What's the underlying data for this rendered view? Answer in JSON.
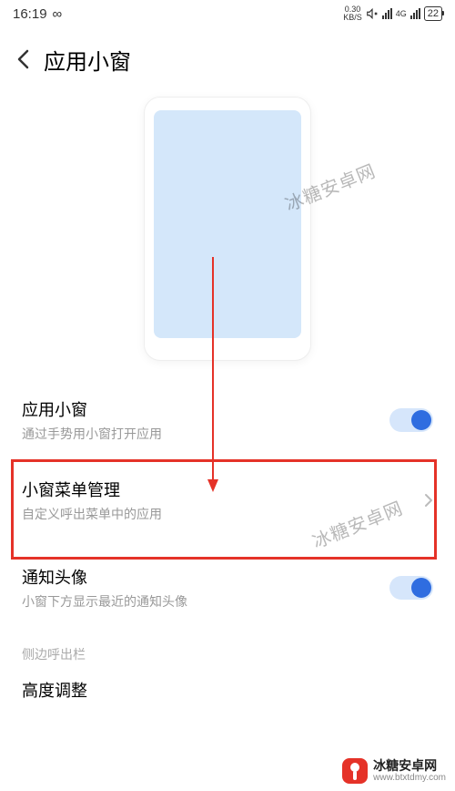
{
  "status": {
    "time": "16:19",
    "infinity_symbol": "∞",
    "speed_top": "0.30",
    "speed_bottom": "KB/S",
    "net_label": "4G",
    "battery": "22"
  },
  "header": {
    "title": "应用小窗"
  },
  "settings": {
    "app_window": {
      "title": "应用小窗",
      "subtitle": "通过手势用小窗打开应用",
      "on": true
    },
    "menu_mgmt": {
      "title": "小窗菜单管理",
      "subtitle": "自定义呼出菜单中的应用"
    },
    "notif_avatar": {
      "title": "通知头像",
      "subtitle": "小窗下方显示最近的通知头像",
      "on": true
    },
    "section_label": "侧边呼出栏",
    "height_adjust": {
      "title": "高度调整"
    }
  },
  "watermark": {
    "text": "冰糖安卓网"
  },
  "footer": {
    "name": "冰糖安卓网",
    "url": "www.btxtdmy.com"
  }
}
